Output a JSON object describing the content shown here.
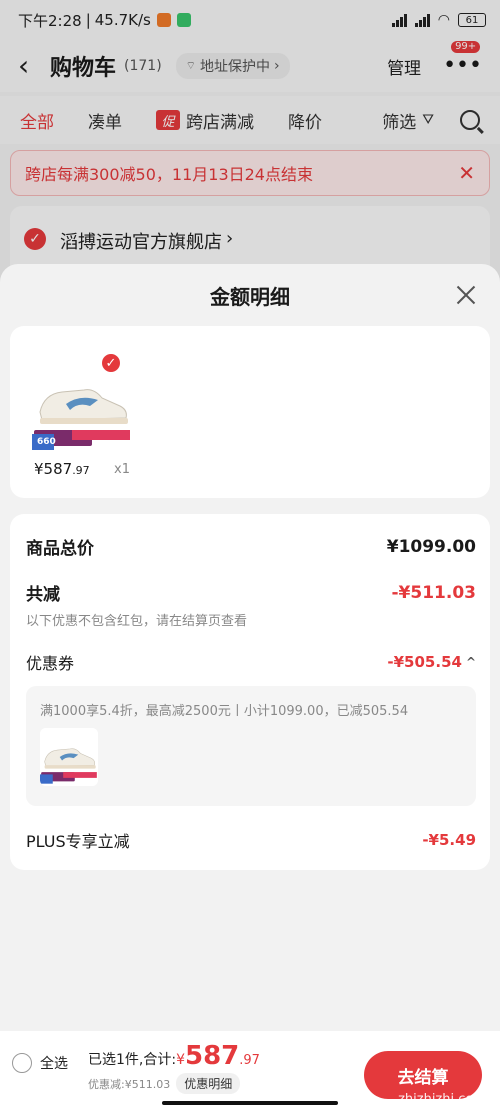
{
  "status_bar": {
    "time": "下午2:28",
    "speed": "45.7K/s",
    "battery": "61"
  },
  "nav": {
    "title": "购物车",
    "count": "(171)",
    "address": "地址保护中",
    "manage": "管理",
    "badge": "99+"
  },
  "tabs": [
    {
      "label": "全部",
      "active": true
    },
    {
      "label": "凑单",
      "active": false
    },
    {
      "label": "跨店满减",
      "active": false,
      "tag": "促"
    },
    {
      "label": "降价",
      "active": false
    }
  ],
  "filter_label": "筛选",
  "promo_banner": "跨店每满300减50，11月13日24点结束",
  "store_name": "滔搏运动官方旗舰店",
  "sheet": {
    "title": "金额明细",
    "product": {
      "price_main": "¥587",
      "price_decimal": ".97",
      "qty": "x1",
      "img_tag": "660"
    },
    "total": {
      "label": "商品总价",
      "value": "¥1099.00"
    },
    "reduction": {
      "label": "共减",
      "value": "-¥511.03",
      "note": "以下优惠不包含红包，请在结算页查看"
    },
    "coupon": {
      "label": "优惠券",
      "value": "-¥505.54",
      "desc": "满1000享5.4折，最高减2500元丨小计1099.00，已减505.54"
    },
    "plus": {
      "label": "PLUS专享立减",
      "value": "-¥5.49"
    }
  },
  "bottom": {
    "select_all": "全选",
    "selected_text": "已选1件,合计:",
    "yen": "¥",
    "amount_main": "587",
    "amount_decimal": ".97",
    "discount_text": "优惠减:¥511.03",
    "detail_btn": "优惠明细",
    "checkout": "去结算",
    "watermark": "zhizhizhi.com"
  },
  "colors": {
    "accent": "#e4393c",
    "text": "#1a1a1a",
    "muted": "#888888"
  }
}
